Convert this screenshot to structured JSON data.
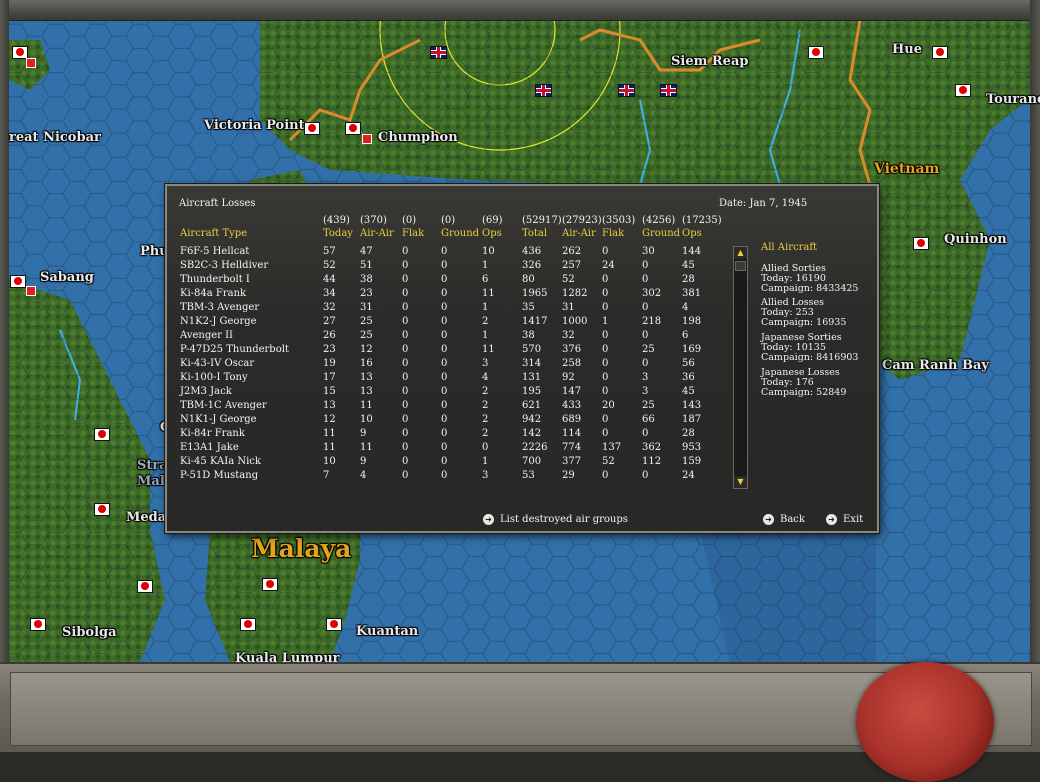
{
  "map": {
    "labels": [
      {
        "name": "label-hue",
        "text": "Hue"
      },
      {
        "name": "label-siem-reap",
        "text": "Siem Reap"
      },
      {
        "name": "label-tourane",
        "text": "Tourane"
      },
      {
        "name": "label-great-nicobar",
        "text": "reat Nicobar"
      },
      {
        "name": "label-victoria-point",
        "text": "Victoria Point"
      },
      {
        "name": "label-chumphon",
        "text": "Chumphon"
      },
      {
        "name": "label-vietnam",
        "text": "Vietnam"
      },
      {
        "name": "label-quinhon",
        "text": "Quinhon"
      },
      {
        "name": "label-sabang",
        "text": "Sabang"
      },
      {
        "name": "label-phu",
        "text": "Phu"
      },
      {
        "name": "label-cam-ranh-bay",
        "text": "Cam Ranh Bay"
      },
      {
        "name": "label-medan",
        "text": "Medan"
      },
      {
        "name": "label-malaya",
        "text": "Malaya"
      },
      {
        "name": "label-sibolga",
        "text": "Sibolga"
      },
      {
        "name": "label-kuantan",
        "text": "Kuantan"
      },
      {
        "name": "label-kuala-lumpur",
        "text": "Kuala Lumpur"
      },
      {
        "name": "label-strait",
        "text": "Stra"
      },
      {
        "name": "label-malacca",
        "text": "Mal"
      },
      {
        "name": "label-c",
        "text": "C"
      }
    ]
  },
  "dialog": {
    "title": "Aircraft Losses",
    "date": "Date: Jan 7, 1945",
    "totals": [
      "(439)",
      "(370)",
      "(0)",
      "(0)",
      "(69)",
      "(52917)",
      "(27923)",
      "(3503)",
      "(4256)",
      "(17235)"
    ],
    "headers": [
      "Aircraft Type",
      "Today",
      "Air-Air",
      "Flak",
      "Ground",
      "Ops",
      "Total",
      "Air-Air",
      "Flak",
      "Ground",
      "Ops"
    ],
    "rows": [
      [
        "F6F-5 Hellcat",
        "57",
        "47",
        "0",
        "0",
        "10",
        "436",
        "262",
        "0",
        "30",
        "144"
      ],
      [
        "SB2C-3 Helldiver",
        "52",
        "51",
        "0",
        "0",
        "1",
        "326",
        "257",
        "24",
        "0",
        "45"
      ],
      [
        "Thunderbolt I",
        "44",
        "38",
        "0",
        "0",
        "6",
        "80",
        "52",
        "0",
        "0",
        "28"
      ],
      [
        "Ki-84a Frank",
        "34",
        "23",
        "0",
        "0",
        "11",
        "1965",
        "1282",
        "0",
        "302",
        "381"
      ],
      [
        "TBM-3 Avenger",
        "32",
        "31",
        "0",
        "0",
        "1",
        "35",
        "31",
        "0",
        "0",
        "4"
      ],
      [
        "N1K2-J George",
        "27",
        "25",
        "0",
        "0",
        "2",
        "1417",
        "1000",
        "1",
        "218",
        "198"
      ],
      [
        "Avenger II",
        "26",
        "25",
        "0",
        "0",
        "1",
        "38",
        "32",
        "0",
        "0",
        "6"
      ],
      [
        "P-47D25 Thunderbolt",
        "23",
        "12",
        "0",
        "0",
        "11",
        "570",
        "376",
        "0",
        "25",
        "169"
      ],
      [
        "Ki-43-IV Oscar",
        "19",
        "16",
        "0",
        "0",
        "3",
        "314",
        "258",
        "0",
        "0",
        "56"
      ],
      [
        "Ki-100-I Tony",
        "17",
        "13",
        "0",
        "0",
        "4",
        "131",
        "92",
        "0",
        "3",
        "36"
      ],
      [
        "J2M3 Jack",
        "15",
        "13",
        "0",
        "0",
        "2",
        "195",
        "147",
        "0",
        "3",
        "45"
      ],
      [
        "TBM-1C Avenger",
        "13",
        "11",
        "0",
        "0",
        "2",
        "621",
        "433",
        "20",
        "25",
        "143"
      ],
      [
        "N1K1-J George",
        "12",
        "10",
        "0",
        "0",
        "2",
        "942",
        "689",
        "0",
        "66",
        "187"
      ],
      [
        "Ki-84r Frank",
        "11",
        "9",
        "0",
        "0",
        "2",
        "142",
        "114",
        "0",
        "0",
        "28"
      ],
      [
        "E13A1 Jake",
        "11",
        "11",
        "0",
        "0",
        "0",
        "2226",
        "774",
        "137",
        "362",
        "953"
      ],
      [
        "Ki-45 KAIa Nick",
        "10",
        "9",
        "0",
        "0",
        "1",
        "700",
        "377",
        "52",
        "112",
        "159"
      ],
      [
        "P-51D Mustang",
        "7",
        "4",
        "0",
        "0",
        "3",
        "53",
        "29",
        "0",
        "0",
        "24"
      ]
    ],
    "sidebar": {
      "filter": "All Aircraft",
      "groups": [
        {
          "title": "Allied Sorties",
          "today": "Today:   16190",
          "campaign": "Campaign: 8433425"
        },
        {
          "title": "Allied Losses",
          "today": "Today:   253",
          "campaign": "Campaign: 16935"
        },
        {
          "title": "Japanese Sorties",
          "today": "Today:   10135",
          "campaign": "Campaign: 8416903"
        },
        {
          "title": "Japanese Losses",
          "today": "Today:   176",
          "campaign": "Campaign: 52849"
        }
      ]
    },
    "buttons": {
      "list_groups": "List destroyed air groups",
      "back": "Back",
      "exit": "Exit"
    }
  },
  "colors": {
    "accent_yellow": "#e8d23a",
    "map_sea": "#2f6aa3",
    "map_land": "#3f6a2a",
    "label_gold": "#e6a21e"
  }
}
